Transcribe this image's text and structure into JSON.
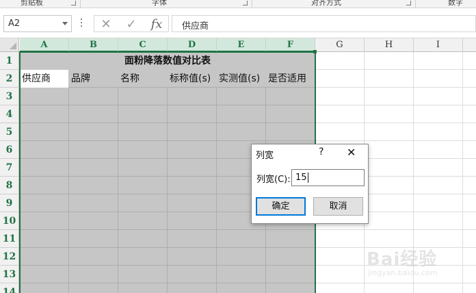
{
  "ribbon": {
    "groups": [
      "剪贴板",
      "字体",
      "对齐方式",
      "数字"
    ]
  },
  "formula_bar": {
    "name_box": "A2",
    "cancel_icon": "✕",
    "confirm_icon": "✓",
    "fx_label": "fx",
    "content": "供应商"
  },
  "grid": {
    "columns": [
      "A",
      "B",
      "C",
      "D",
      "E",
      "F",
      "G",
      "H",
      "I"
    ],
    "rows": [
      "1",
      "2",
      "3",
      "4",
      "5",
      "6",
      "7",
      "8",
      "9",
      "10",
      "11",
      "12",
      "13",
      "14"
    ],
    "title": "面粉降落数值对比表",
    "headers": [
      "供应商",
      "品牌",
      "名称",
      "标称值(s)",
      "实测值(s)",
      "是否适用"
    ]
  },
  "dialog": {
    "title": "列宽",
    "help": "?",
    "close": "✕",
    "field_label": "列宽(C):",
    "field_value": "15",
    "ok_label": "确定",
    "cancel_label": "取消"
  },
  "watermark": {
    "brand": "Bai经验",
    "url": "jingyan.baidu.com"
  },
  "colors": {
    "accent": "#217346",
    "selection": "#c6c6c6",
    "dialog_focus": "#0078d7"
  }
}
